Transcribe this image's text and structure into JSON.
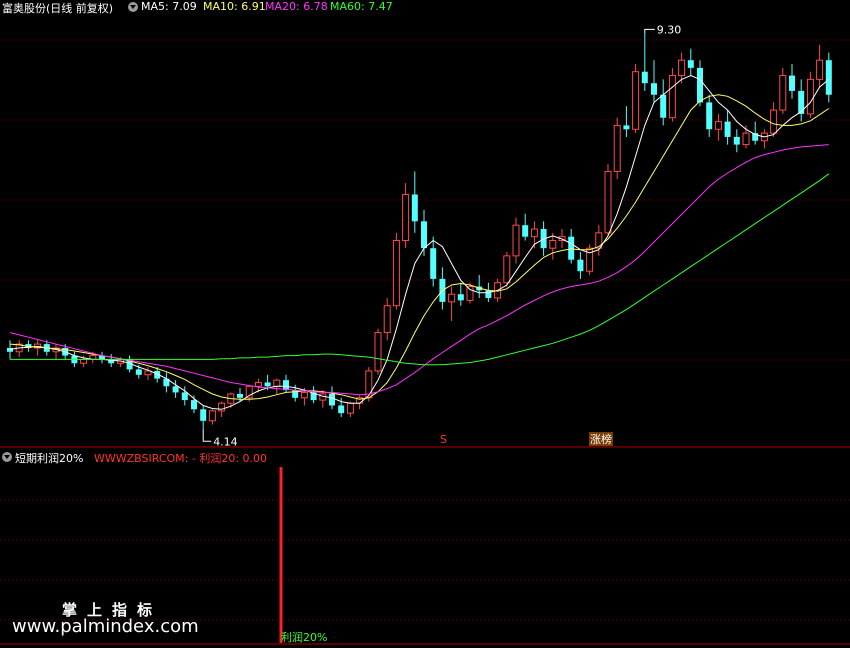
{
  "main_panel": {
    "stock_title": "富奥股份(日线 前复权)",
    "indicators": [
      {
        "label": "MA5: 7.09",
        "color": "#ffffff"
      },
      {
        "label": "MA10: 6.91",
        "color": "#ffff66"
      },
      {
        "label": "MA20: 6.78",
        "color": "#ff33ff"
      },
      {
        "label": "MA60: 7.47",
        "color": "#33ff33"
      }
    ],
    "high_label": "9.30",
    "low_label": "4.14",
    "marker_s": "S",
    "marker_surge": "涨榜"
  },
  "sub_panel": {
    "title": "短期利润20%",
    "formula": "WWWZBSIRCOM: - 利润20: 0.00",
    "bar_label": "利润20%"
  },
  "watermark": {
    "cn": "掌上指标",
    "url": "www.palmindex.com"
  },
  "colors": {
    "up": "#ff4a4a",
    "down": "#54ffff",
    "grid": "#7a0000",
    "signal": "#ff2020",
    "bar_label": "#33ff33"
  },
  "chart_data": {
    "type": "candlestick",
    "title": "富奥股份(日线 前复权)",
    "ohlc_fields": [
      "open",
      "high",
      "low",
      "close"
    ],
    "candles": [
      [
        5.2,
        5.3,
        5.05,
        5.15
      ],
      [
        5.15,
        5.3,
        5.08,
        5.25
      ],
      [
        5.25,
        5.3,
        5.15,
        5.2
      ],
      [
        5.2,
        5.3,
        5.1,
        5.25
      ],
      [
        5.25,
        5.3,
        5.1,
        5.15
      ],
      [
        5.15,
        5.25,
        5.05,
        5.2
      ],
      [
        5.2,
        5.25,
        5.05,
        5.1
      ],
      [
        5.1,
        5.15,
        4.95,
        5.0
      ],
      [
        5.0,
        5.1,
        4.95,
        5.05
      ],
      [
        5.05,
        5.15,
        5.0,
        5.1
      ],
      [
        5.1,
        5.15,
        5.0,
        5.05
      ],
      [
        5.05,
        5.12,
        4.95,
        5.0
      ],
      [
        5.0,
        5.08,
        4.95,
        5.05
      ],
      [
        5.05,
        5.1,
        4.88,
        4.92
      ],
      [
        4.92,
        4.98,
        4.8,
        4.85
      ],
      [
        4.85,
        4.95,
        4.78,
        4.9
      ],
      [
        4.9,
        4.95,
        4.75,
        4.8
      ],
      [
        4.8,
        4.88,
        4.62,
        4.7
      ],
      [
        4.7,
        4.78,
        4.55,
        4.62
      ],
      [
        4.62,
        4.7,
        4.45,
        4.52
      ],
      [
        4.52,
        4.58,
        4.35,
        4.4
      ],
      [
        4.4,
        4.45,
        4.14,
        4.25
      ],
      [
        4.25,
        4.4,
        4.2,
        4.38
      ],
      [
        4.38,
        4.5,
        4.3,
        4.48
      ],
      [
        4.48,
        4.62,
        4.42,
        4.6
      ],
      [
        4.6,
        4.68,
        4.5,
        4.55
      ],
      [
        4.55,
        4.72,
        4.5,
        4.7
      ],
      [
        4.7,
        4.8,
        4.62,
        4.75
      ],
      [
        4.75,
        4.85,
        4.65,
        4.7
      ],
      [
        4.7,
        4.8,
        4.6,
        4.78
      ],
      [
        4.78,
        4.85,
        4.62,
        4.65
      ],
      [
        4.65,
        4.72,
        4.5,
        4.55
      ],
      [
        4.55,
        4.68,
        4.45,
        4.62
      ],
      [
        4.62,
        4.7,
        4.48,
        4.52
      ],
      [
        4.52,
        4.65,
        4.42,
        4.6
      ],
      [
        4.6,
        4.7,
        4.4,
        4.45
      ],
      [
        4.45,
        4.55,
        4.3,
        4.35
      ],
      [
        4.35,
        4.5,
        4.3,
        4.48
      ],
      [
        4.48,
        4.58,
        4.4,
        4.55
      ],
      [
        4.55,
        4.95,
        4.5,
        4.9
      ],
      [
        4.9,
        5.45,
        4.85,
        5.4
      ],
      [
        5.4,
        5.85,
        5.3,
        5.75
      ],
      [
        5.75,
        6.7,
        5.7,
        6.6
      ],
      [
        6.6,
        7.35,
        6.5,
        7.2
      ],
      [
        7.2,
        7.5,
        6.7,
        6.85
      ],
      [
        6.85,
        7.0,
        6.4,
        6.5
      ],
      [
        6.5,
        6.65,
        6.0,
        6.1
      ],
      [
        6.1,
        6.25,
        5.7,
        5.8
      ],
      [
        5.8,
        6.0,
        5.55,
        5.9
      ],
      [
        5.9,
        6.05,
        5.75,
        5.82
      ],
      [
        5.82,
        6.05,
        5.78,
        6.0
      ],
      [
        6.0,
        6.15,
        5.85,
        5.95
      ],
      [
        5.95,
        6.05,
        5.8,
        5.85
      ],
      [
        5.85,
        6.1,
        5.8,
        6.05
      ],
      [
        6.05,
        6.45,
        6.0,
        6.4
      ],
      [
        6.4,
        6.9,
        6.3,
        6.8
      ],
      [
        6.8,
        6.95,
        6.6,
        6.65
      ],
      [
        6.65,
        6.85,
        6.5,
        6.75
      ],
      [
        6.75,
        6.85,
        6.4,
        6.5
      ],
      [
        6.5,
        6.7,
        6.35,
        6.6
      ],
      [
        6.6,
        6.75,
        6.5,
        6.65
      ],
      [
        6.65,
        6.75,
        6.3,
        6.35
      ],
      [
        6.35,
        6.45,
        6.1,
        6.2
      ],
      [
        6.2,
        6.55,
        6.15,
        6.5
      ],
      [
        6.5,
        6.8,
        6.4,
        6.7
      ],
      [
        6.7,
        7.6,
        6.65,
        7.5
      ],
      [
        7.5,
        8.2,
        7.4,
        8.1
      ],
      [
        8.1,
        8.35,
        7.95,
        8.05
      ],
      [
        8.05,
        8.9,
        8.0,
        8.8
      ],
      [
        8.8,
        9.3,
        8.55,
        8.65
      ],
      [
        8.65,
        8.95,
        8.4,
        8.5
      ],
      [
        8.5,
        8.7,
        8.1,
        8.2
      ],
      [
        8.2,
        8.85,
        8.15,
        8.75
      ],
      [
        8.75,
        9.05,
        8.65,
        8.95
      ],
      [
        8.95,
        9.1,
        8.75,
        8.85
      ],
      [
        8.85,
        8.95,
        8.35,
        8.4
      ],
      [
        8.4,
        8.5,
        7.95,
        8.05
      ],
      [
        8.05,
        8.25,
        7.9,
        8.15
      ],
      [
        8.15,
        8.3,
        7.85,
        7.95
      ],
      [
        7.95,
        8.05,
        7.75,
        7.85
      ],
      [
        7.85,
        8.1,
        7.8,
        8.0
      ],
      [
        8.0,
        8.15,
        7.85,
        7.9
      ],
      [
        7.9,
        8.05,
        7.8,
        8.0
      ],
      [
        8.0,
        8.4,
        7.95,
        8.3
      ],
      [
        8.3,
        8.85,
        8.25,
        8.75
      ],
      [
        8.75,
        8.9,
        8.45,
        8.55
      ],
      [
        8.55,
        8.7,
        8.15,
        8.25
      ],
      [
        8.25,
        8.8,
        8.2,
        8.7
      ],
      [
        8.7,
        9.15,
        8.6,
        8.95
      ],
      [
        8.95,
        9.05,
        8.4,
        8.5
      ]
    ],
    "ma": {
      "MA5": [
        5.18,
        5.2,
        5.21,
        5.22,
        5.2,
        5.18,
        5.15,
        5.1,
        5.07,
        5.05,
        5.05,
        5.04,
        5.03,
        5.0,
        4.95,
        4.91,
        4.86,
        4.8,
        4.72,
        4.64,
        4.54,
        4.45,
        4.41,
        4.4,
        4.44,
        4.5,
        4.58,
        4.64,
        4.68,
        4.7,
        4.7,
        4.68,
        4.65,
        4.61,
        4.57,
        4.55,
        4.5,
        4.48,
        4.48,
        4.58,
        4.78,
        5.05,
        5.45,
        5.9,
        6.3,
        6.5,
        6.6,
        6.52,
        6.3,
        6.08,
        5.96,
        5.92,
        5.92,
        5.95,
        6.02,
        6.2,
        6.38,
        6.55,
        6.62,
        6.66,
        6.62,
        6.56,
        6.48,
        6.44,
        6.48,
        6.66,
        6.95,
        7.3,
        7.7,
        8.1,
        8.4,
        8.5,
        8.6,
        8.7,
        8.75,
        8.7,
        8.55,
        8.4,
        8.3,
        8.15,
        8.05,
        7.98,
        7.95,
        7.98,
        8.1,
        8.2,
        8.28,
        8.4,
        8.6,
        8.7
      ],
      "MA10": [
        5.25,
        5.24,
        5.22,
        5.21,
        5.2,
        5.19,
        5.18,
        5.16,
        5.14,
        5.12,
        5.1,
        5.08,
        5.06,
        5.03,
        5.0,
        4.97,
        4.93,
        4.89,
        4.84,
        4.79,
        4.72,
        4.66,
        4.6,
        4.56,
        4.54,
        4.53,
        4.53,
        4.54,
        4.56,
        4.59,
        4.62,
        4.63,
        4.64,
        4.64,
        4.63,
        4.61,
        4.59,
        4.56,
        4.53,
        4.55,
        4.63,
        4.75,
        4.94,
        5.16,
        5.4,
        5.62,
        5.8,
        5.95,
        6.02,
        6.04,
        6.02,
        5.98,
        5.95,
        5.94,
        5.97,
        6.06,
        6.17,
        6.28,
        6.38,
        6.44,
        6.47,
        6.49,
        6.48,
        6.48,
        6.52,
        6.62,
        6.76,
        6.92,
        7.1,
        7.3,
        7.5,
        7.7,
        7.9,
        8.1,
        8.3,
        8.42,
        8.48,
        8.5,
        8.48,
        8.42,
        8.35,
        8.26,
        8.18,
        8.12,
        8.1,
        8.1,
        8.12,
        8.16,
        8.24,
        8.32
      ],
      "MA20": [
        5.4,
        5.37,
        5.34,
        5.31,
        5.28,
        5.25,
        5.22,
        5.19,
        5.16,
        5.13,
        5.1,
        5.08,
        5.06,
        5.04,
        5.02,
        5.0,
        4.98,
        4.96,
        4.93,
        4.9,
        4.87,
        4.84,
        4.81,
        4.78,
        4.75,
        4.73,
        4.71,
        4.69,
        4.68,
        4.67,
        4.66,
        4.65,
        4.64,
        4.63,
        4.62,
        4.62,
        4.61,
        4.6,
        4.59,
        4.6,
        4.63,
        4.67,
        4.72,
        4.8,
        4.88,
        4.97,
        5.06,
        5.14,
        5.22,
        5.3,
        5.38,
        5.45,
        5.5,
        5.56,
        5.62,
        5.69,
        5.76,
        5.82,
        5.88,
        5.93,
        5.97,
        6.0,
        6.02,
        6.04,
        6.07,
        6.12,
        6.18,
        6.26,
        6.35,
        6.46,
        6.58,
        6.7,
        6.82,
        6.94,
        7.06,
        7.18,
        7.3,
        7.4,
        7.48,
        7.55,
        7.62,
        7.68,
        7.72,
        7.75,
        7.78,
        7.8,
        7.82,
        7.83,
        7.84,
        7.85
      ],
      "MA60": [
        5.05,
        5.05,
        5.05,
        5.05,
        5.05,
        5.05,
        5.05,
        5.05,
        5.05,
        5.05,
        5.05,
        5.05,
        5.05,
        5.05,
        5.05,
        5.05,
        5.05,
        5.05,
        5.05,
        5.05,
        5.05,
        5.05,
        5.05,
        5.06,
        5.06,
        5.07,
        5.07,
        5.08,
        5.08,
        5.09,
        5.1,
        5.1,
        5.11,
        5.11,
        5.12,
        5.12,
        5.11,
        5.1,
        5.09,
        5.08,
        5.06,
        5.04,
        5.02,
        5.0,
        4.99,
        4.98,
        4.98,
        4.98,
        4.99,
        5.0,
        5.01,
        5.03,
        5.05,
        5.08,
        5.11,
        5.14,
        5.17,
        5.2,
        5.23,
        5.26,
        5.3,
        5.34,
        5.38,
        5.43,
        5.49,
        5.56,
        5.63,
        5.7,
        5.78,
        5.86,
        5.94,
        6.02,
        6.1,
        6.18,
        6.26,
        6.34,
        6.42,
        6.5,
        6.58,
        6.66,
        6.74,
        6.82,
        6.9,
        6.98,
        7.06,
        7.14,
        7.22,
        7.3,
        7.38,
        7.47
      ]
    },
    "y_range": [
      4.0,
      9.5
    ],
    "signal_value": 0.0,
    "signal_bar_index": 39
  }
}
